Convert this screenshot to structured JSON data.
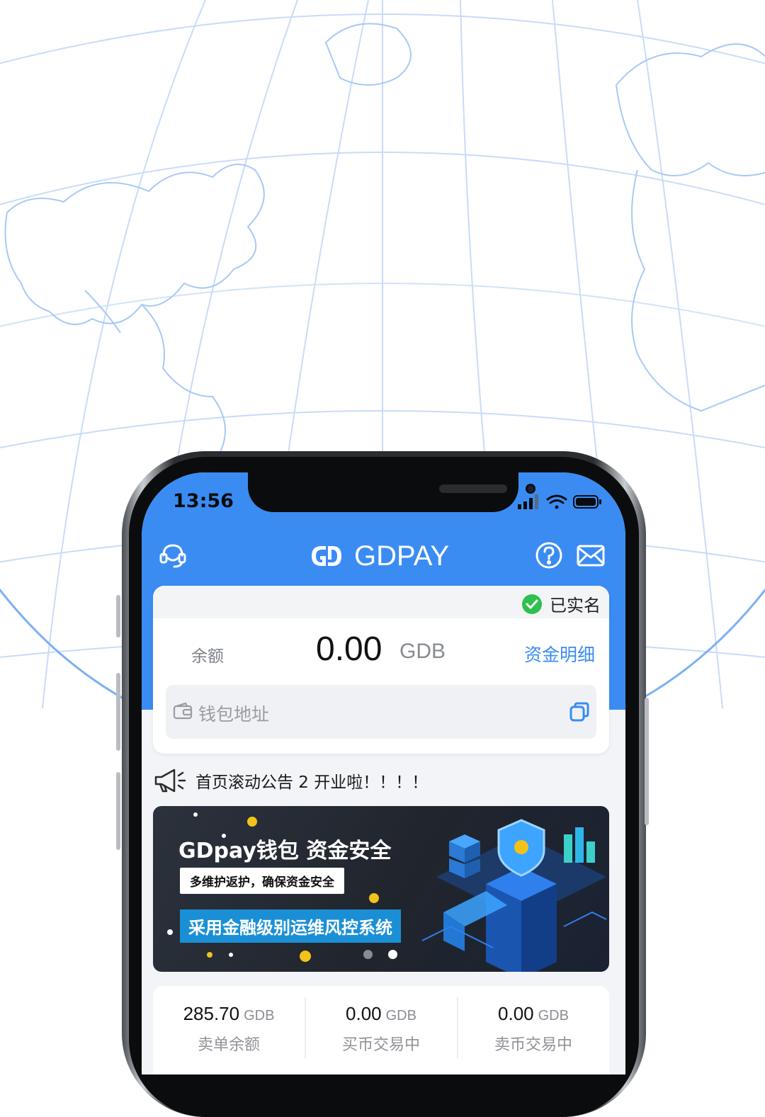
{
  "status_bar": {
    "time": "13:56"
  },
  "app": {
    "title": "GDPAY",
    "logo_text": "GD"
  },
  "colors": {
    "accent": "#3a8cf3",
    "verified": "#2fbf4d",
    "banner_bg": "#20252d",
    "banner_highlight": "#1b8fd6"
  },
  "account": {
    "verified_label": "已实名",
    "balance_label": "余额",
    "balance_amount": "0.00",
    "balance_unit": "GDB",
    "fund_detail_link": "资金明细",
    "wallet_address_placeholder": "钱包地址"
  },
  "notice": {
    "text": "首页滚动公告 2 开业啦！！！！"
  },
  "banner": {
    "title": "GDpay钱包 资金安全",
    "subtitle": "多维护返护，确保资金安全",
    "tagline": "采用金融级别运维风控系统",
    "slide_count": 2,
    "active_slide": 2
  },
  "stats": [
    {
      "value": "285.70",
      "unit": "GDB",
      "label": "卖单余额"
    },
    {
      "value": "0.00",
      "unit": "GDB",
      "label": "买币交易中"
    },
    {
      "value": "0.00",
      "unit": "GDB",
      "label": "卖币交易中"
    }
  ],
  "icons": [
    "support-icon",
    "help-icon",
    "mail-icon",
    "check-circle-icon",
    "wallet-icon",
    "copy-icon",
    "megaphone-icon"
  ]
}
